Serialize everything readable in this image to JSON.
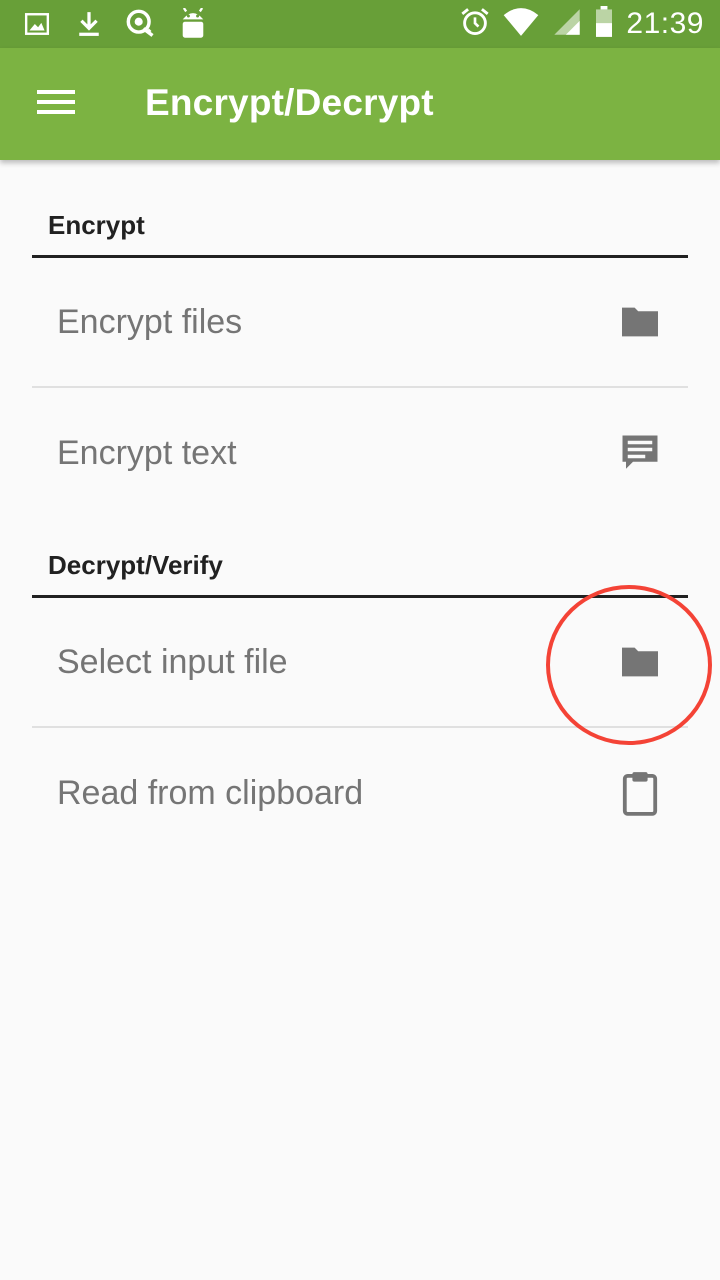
{
  "status_bar": {
    "time": "21:39",
    "left_icons": [
      "image-icon",
      "download-icon",
      "pgp-key-icon",
      "android-icon"
    ],
    "right_icons": [
      "alarm-icon",
      "wifi-icon",
      "signal-icon",
      "battery-icon"
    ],
    "bg_color": "#689f38"
  },
  "app_bar": {
    "title": "Encrypt/Decrypt",
    "menu_icon": "menu-icon",
    "bg_color": "#7cb342"
  },
  "sections": {
    "encrypt": {
      "header": "Encrypt",
      "items": [
        {
          "label": "Encrypt files",
          "icon": "folder-icon"
        },
        {
          "label": "Encrypt text",
          "icon": "message-icon"
        }
      ]
    },
    "decrypt": {
      "header": "Decrypt/Verify",
      "items": [
        {
          "label": "Select input file",
          "icon": "folder-icon"
        },
        {
          "label": "Read from clipboard",
          "icon": "clipboard-icon"
        }
      ]
    }
  },
  "annotation": {
    "color": "#f44336"
  }
}
